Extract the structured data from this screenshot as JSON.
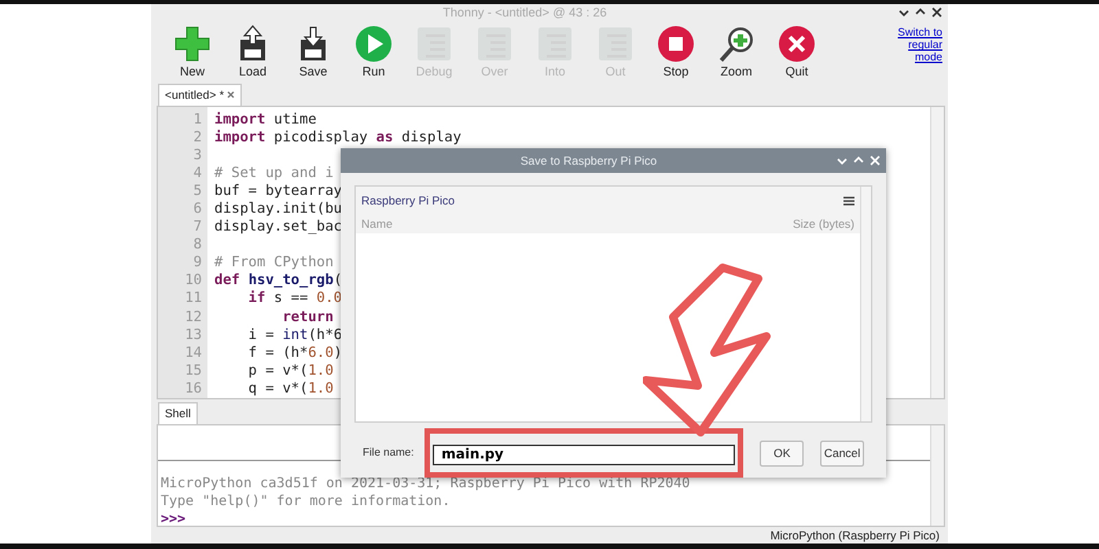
{
  "window": {
    "title": "Thonny  -  <untitled>  @  43 : 26"
  },
  "toolbar": [
    {
      "kind": "new",
      "label": "New",
      "disabled": false
    },
    {
      "kind": "load",
      "label": "Load",
      "disabled": false
    },
    {
      "kind": "save",
      "label": "Save",
      "disabled": false
    },
    {
      "kind": "run",
      "label": "Run",
      "disabled": false
    },
    {
      "kind": "debug",
      "label": "Debug",
      "disabled": true
    },
    {
      "kind": "over",
      "label": "Over",
      "disabled": true
    },
    {
      "kind": "into",
      "label": "Into",
      "disabled": true
    },
    {
      "kind": "out",
      "label": "Out",
      "disabled": true
    },
    {
      "kind": "stop",
      "label": "Stop",
      "disabled": false
    },
    {
      "kind": "zoom",
      "label": "Zoom",
      "disabled": false
    },
    {
      "kind": "quit",
      "label": "Quit",
      "disabled": false
    }
  ],
  "mode_link": "Switch to regular mode",
  "editor_tabs": [
    {
      "label": "<untitled> *",
      "selected": true
    }
  ],
  "editor_lines": [
    {
      "number": "1",
      "tokens": [
        {
          "kind": "keyword",
          "text": "import"
        },
        {
          "kind": "plain",
          "text": " utime"
        }
      ]
    },
    {
      "number": "2",
      "tokens": [
        {
          "kind": "keyword",
          "text": "import"
        },
        {
          "kind": "plain",
          "text": " picodisplay "
        },
        {
          "kind": "keyword",
          "text": "as"
        },
        {
          "kind": "plain",
          "text": " display"
        }
      ]
    },
    {
      "number": "3"
    },
    {
      "number": "4",
      "tokens": [
        {
          "kind": "comment",
          "text": "# Set up and i"
        }
      ]
    },
    {
      "number": "5",
      "tokens": [
        {
          "kind": "plain",
          "text": "buf = bytearray"
        }
      ]
    },
    {
      "number": "6",
      "tokens": [
        {
          "kind": "plain",
          "text": "display.init(bu"
        }
      ]
    },
    {
      "number": "7",
      "tokens": [
        {
          "kind": "plain",
          "text": "display.set_bac"
        }
      ]
    },
    {
      "number": "8"
    },
    {
      "number": "9",
      "tokens": [
        {
          "kind": "comment",
          "text": "# From CPython"
        }
      ]
    },
    {
      "number": "10",
      "tokens": [
        {
          "kind": "keyword",
          "text": "def "
        },
        {
          "kind": "function",
          "text": "hsv_to_rgb"
        },
        {
          "kind": "plain",
          "text": "("
        }
      ]
    },
    {
      "number": "11",
      "tokens": [
        {
          "kind": "keyword",
          "text": "    if"
        },
        {
          "kind": "plain",
          "text": " s == "
        },
        {
          "kind": "number",
          "text": "0.0"
        }
      ]
    },
    {
      "number": "12",
      "tokens": [
        {
          "kind": "keyword",
          "text": "        return"
        }
      ]
    },
    {
      "number": "13",
      "tokens": [
        {
          "kind": "plain",
          "text": "    i = "
        },
        {
          "kind": "builtin",
          "text": "int"
        },
        {
          "kind": "plain",
          "text": "(h*6"
        }
      ]
    },
    {
      "number": "14",
      "tokens": [
        {
          "kind": "plain",
          "text": "    f = (h*"
        },
        {
          "kind": "number",
          "text": "6.0"
        },
        {
          "kind": "plain",
          "text": ")"
        }
      ]
    },
    {
      "number": "15",
      "tokens": [
        {
          "kind": "plain",
          "text": "    p = v*("
        },
        {
          "kind": "number",
          "text": "1.0"
        }
      ]
    },
    {
      "number": "16",
      "tokens": [
        {
          "kind": "plain",
          "text": "    q = v*("
        },
        {
          "kind": "number",
          "text": "1.0"
        }
      ]
    }
  ],
  "shell_tabs": [
    {
      "label": "Shell",
      "selected": true
    }
  ],
  "shell_lines": [
    {
      "kind": "output",
      "text": "MicroPython ca3d51f on 2021-03-31; Raspberry Pi Pico with RP2040"
    },
    {
      "kind": "output",
      "text": "Type \"help()\" for more information."
    },
    {
      "kind": "prompt",
      "text": ">>>"
    }
  ],
  "status_bar": "MicroPython (Raspberry Pi Pico)",
  "dialog": {
    "title": "Save to Raspberry Pi Pico",
    "location": "Raspberry Pi Pico",
    "columns": [
      "Name",
      "Size (bytes)"
    ],
    "file_label": "File name:",
    "file_name": "main.py",
    "buttons": [
      "OK",
      "Cancel"
    ]
  }
}
